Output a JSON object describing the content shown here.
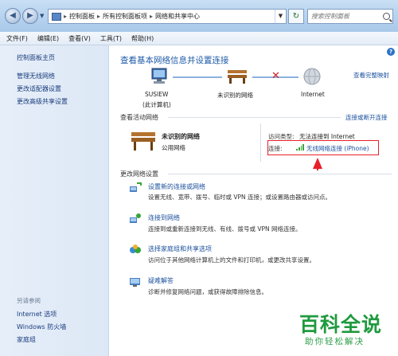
{
  "address_bar": {
    "breadcrumbs": [
      "控制面板",
      "所有控制面板项",
      "网络和共享中心"
    ],
    "search_placeholder": "搜索控制面板"
  },
  "menu": [
    "文件(F)",
    "编辑(E)",
    "查看(V)",
    "工具(T)",
    "帮助(H)"
  ],
  "left_pane": {
    "home": "控制面板主页",
    "links": [
      "管理无线网络",
      "更改适配器设置",
      "更改高级共享设置"
    ],
    "see_also_title": "另请参阅",
    "see_also": [
      "Internet 选项",
      "Windows 防火墙",
      "家庭组"
    ]
  },
  "main": {
    "title": "查看基本网络信息并设置连接",
    "full_map_link": "查看完整映射",
    "map": {
      "computer_name": "SUSIEW",
      "computer_sub": "(此计算机)",
      "network": "未识别的网络",
      "internet": "Internet"
    },
    "active_networks": {
      "header": "查看活动网络",
      "connect_link": "连接或断开连接",
      "network_name": "未识别的网络",
      "network_type": "公用网络",
      "access_label": "访问类型:",
      "access_value": "无法连接到 Internet",
      "connection_label": "连接:",
      "connection_value": "无线网络连接 (iPhone)"
    },
    "change_settings": {
      "header": "更改网络设置",
      "tasks": [
        {
          "title": "设置新的连接或网络",
          "desc": "设置无线、宽带、拨号、临时或 VPN 连接；或设置路由器或访问点。"
        },
        {
          "title": "连接到网络",
          "desc": "连接到或重新连接到无线、有线、拨号或 VPN 网络连接。"
        },
        {
          "title": "选择家庭组和共享选项",
          "desc": "访问位于其他网络计算机上的文件和打印机，或更改共享设置。"
        },
        {
          "title": "疑难解答",
          "desc": "诊断并修复网络问题，或获得故障排除信息。"
        }
      ]
    }
  },
  "watermark": {
    "title": "百科全说",
    "subtitle": "助你轻松解决"
  },
  "colors": {
    "link": "#1a4f9c",
    "title": "#1e5aa8",
    "highlight": "#e8202a",
    "watermark": "#1f9a3f"
  }
}
